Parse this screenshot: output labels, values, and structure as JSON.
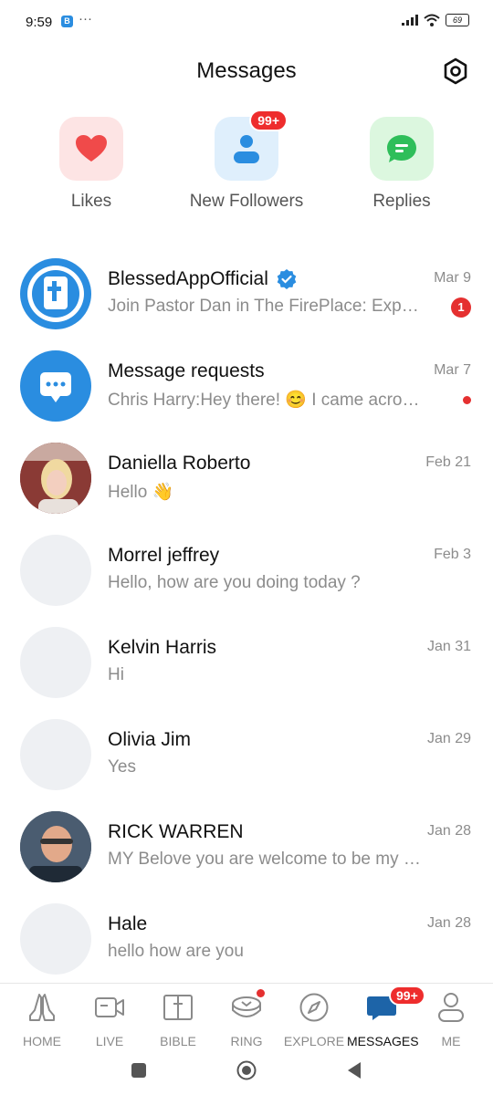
{
  "status_bar": {
    "time": "9:59",
    "dots": "···",
    "battery": "69"
  },
  "header": {
    "title": "Messages"
  },
  "categories": [
    {
      "label": "Likes",
      "icon": "heart-icon",
      "color": "#f04a4a",
      "bg": "#fde4e4"
    },
    {
      "label": "New Followers",
      "icon": "person-icon",
      "badge": "99+",
      "color": "#2a8de0",
      "bg": "#dfeffc"
    },
    {
      "label": "Replies",
      "icon": "chat-bubble-icon",
      "color": "#2fbe5a",
      "bg": "#dcf7df"
    }
  ],
  "conversations": [
    {
      "name": "BlessedAppOfficial",
      "verified": true,
      "preview": "Join Pastor Dan in The FirePlace: Exp…",
      "date": "Mar 9",
      "unread": "1"
    },
    {
      "name": "Message requests",
      "preview": "Chris Harry:Hey there! 😊 I came acro…",
      "date": "Mar 7",
      "dot": true
    },
    {
      "name": "Daniella Roberto",
      "preview": "Hello 👋",
      "date": "Feb 21"
    },
    {
      "name": "Morrel jeffrey",
      "preview": "Hello, how are you doing today ?",
      "date": "Feb 3"
    },
    {
      "name": "Kelvin Harris",
      "preview": "Hi",
      "date": "Jan 31"
    },
    {
      "name": "Olivia Jim",
      "preview": "Yes",
      "date": "Jan 29"
    },
    {
      "name": "RICK WARREN",
      "preview": "MY Belove you are welcome to be my …",
      "date": "Jan 28"
    },
    {
      "name": "Hale",
      "preview": "hello how are you",
      "date": "Jan 28"
    }
  ],
  "tabs": [
    {
      "label": "HOME",
      "icon": "praying-hands-icon"
    },
    {
      "label": "LIVE",
      "icon": "video-camera-icon"
    },
    {
      "label": "BIBLE",
      "icon": "bible-icon"
    },
    {
      "label": "RING",
      "icon": "ring-icon",
      "dot": true
    },
    {
      "label": "EXPLORE",
      "icon": "compass-icon"
    },
    {
      "label": "MESSAGES",
      "icon": "message-icon",
      "badge": "99+",
      "active": true
    },
    {
      "label": "ME",
      "icon": "person-outline-icon"
    }
  ],
  "colors": {
    "accent": "#2a8de0",
    "badge": "#ee2d2d",
    "muted": "#8c8c8c"
  }
}
